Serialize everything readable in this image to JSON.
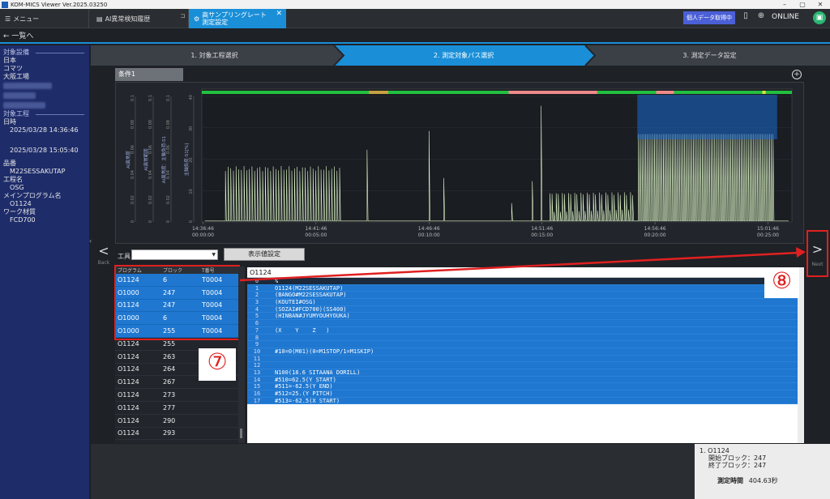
{
  "window": {
    "title": "KOM-MICS Viewer  Ver.2025.03250",
    "controls": [
      "–",
      "▢",
      "✕"
    ]
  },
  "tabs": {
    "menu": "メニュー",
    "history": "AI異常検知履歴",
    "active_line1": "高サンプリングレート",
    "active_line2": "測定設定",
    "close": "✕"
  },
  "header": {
    "personal_badge": "個人データ取得中",
    "online": "ONLINE"
  },
  "back": {
    "label": "← 一覧へ"
  },
  "sidebar": {
    "equipment_label": "対象設備",
    "equipment": [
      "日本",
      "コマツ",
      "大阪工場"
    ],
    "process_label": "対象工程",
    "datetime_label": "日時",
    "start": "2025/03/28 14:36:46",
    "end": "2025/03/28 15:05:40",
    "part_label": "品番",
    "part": "M22SESSAKUTAP",
    "process_name_label": "工程名",
    "process_name": "OSG",
    "main_prog_label": "メインプログラム名",
    "main_prog": "O1124",
    "material_label": "ワーク材質",
    "material": "FCD700"
  },
  "steps": [
    "1. 対象工程選択",
    "2. 測定対象パス選択",
    "3. 測定データ設定"
  ],
  "nav": {
    "prev_label": "Back",
    "next_label": "Next",
    "prev_icon": "<",
    "next_icon": ">"
  },
  "condition_tab": "条件1",
  "chart_data": {
    "type": "line",
    "left_axes": [
      {
        "label": "AI異常度",
        "ticks": [
          "0",
          "0.02",
          "0.04",
          "0.06",
          "0.08",
          "0.1"
        ]
      },
      {
        "label": "AI異常範囲",
        "ticks": [
          "0",
          "0.02",
          "0.04",
          "0.06",
          "0.08",
          "0.1"
        ]
      },
      {
        "label": "AI異常度：主軸負荷-S1",
        "ticks": [
          "0",
          "0.02",
          "0.04",
          "0.06",
          "0.08",
          "0.1"
        ]
      },
      {
        "label": "主軸負荷-S1[%]",
        "ticks": [
          "0",
          "10",
          "20",
          "30",
          "40"
        ]
      }
    ],
    "x_ticks": [
      [
        "14:36:46",
        "00:00:00"
      ],
      [
        "14:41:46",
        "00:05:00"
      ],
      [
        "14:46:46",
        "00:10:00"
      ],
      [
        "14:51:46",
        "00:15:00"
      ],
      [
        "14:56:46",
        "00:20:00"
      ],
      [
        "15:01:46",
        "00:25:00"
      ]
    ],
    "xlabel": "実時間 / 経過時間",
    "y_range": [
      0,
      40
    ]
  },
  "tool": {
    "label": "工具",
    "value": "",
    "setting_button": "表示値設定"
  },
  "block_table": {
    "headers": [
      "プログラム",
      "ブロック",
      "T番号"
    ],
    "rows": [
      [
        "O1124",
        "6",
        "T0004"
      ],
      [
        "O1000",
        "247",
        "T0004"
      ],
      [
        "O1124",
        "247",
        "T0004"
      ],
      [
        "O1000",
        "6",
        "T0004"
      ],
      [
        "O1000",
        "255",
        "T0004"
      ],
      [
        "O1124",
        "255",
        ""
      ],
      [
        "O1124",
        "263",
        ""
      ],
      [
        "O1124",
        "264",
        ""
      ],
      [
        "O1124",
        "267",
        ""
      ],
      [
        "O1124",
        "273",
        ""
      ],
      [
        "O1124",
        "277",
        ""
      ],
      [
        "O1124",
        "290",
        ""
      ],
      [
        "O1124",
        "293",
        ""
      ]
    ]
  },
  "program": {
    "title": "O1124",
    "lines": [
      [
        "0",
        "%"
      ],
      [
        "1",
        "O1124(M22SESSAKUTAP)"
      ],
      [
        "2",
        "(BANGO#M22SESSAKUTAP)"
      ],
      [
        "3",
        "(KOUTEI#OSG)"
      ],
      [
        "4",
        "(SOZAI#FCD700)(SS400)"
      ],
      [
        "5",
        "(HINBAN#JYUMYOUHYOUKA)"
      ],
      [
        "6",
        ""
      ],
      [
        "7",
        "(X    Y    Z   )"
      ],
      [
        "8",
        ""
      ],
      [
        "9",
        ""
      ],
      [
        "10",
        "#10=0(M01)(0=M1STOP/1=M1SKIP)"
      ],
      [
        "11",
        ""
      ],
      [
        "12",
        ""
      ],
      [
        "13",
        "N100(18.6 SITAANA DORILL)"
      ],
      [
        "14",
        "#510=62.5(Y START)"
      ],
      [
        "15",
        "#511=-62.5(Y END)"
      ],
      [
        "16",
        "#512=25.(Y PITCH)"
      ],
      [
        "17",
        "#513=-62.5(X START)"
      ]
    ]
  },
  "summary": {
    "item": "1. O1124",
    "start_block": "開始ブロック：247",
    "end_block": "終了ブロック：247",
    "measure_label": "測定時間",
    "measure_value": "404.63秒"
  },
  "annotations": {
    "seven": "⑦",
    "eight": "⑧"
  },
  "colors": {
    "accent": "#1a8fd8",
    "sidebar": "#1e2c6a",
    "selection": "#1f77d0",
    "annotation": "#e02020",
    "series": "#dff7c8",
    "bar_pink": "#f08a8a",
    "bar_green": "#22c040"
  }
}
